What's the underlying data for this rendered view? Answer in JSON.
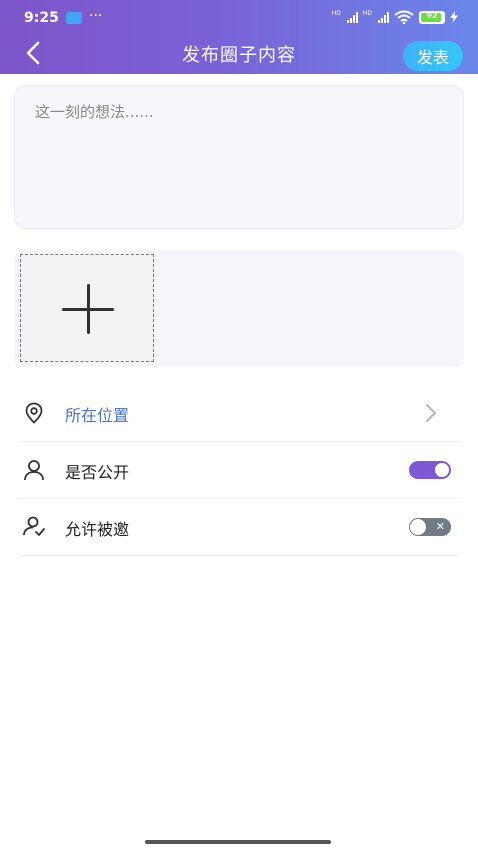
{
  "status_bar": {
    "time": "9:25",
    "overflow": "···",
    "hd1": "HD",
    "hd2": "HD",
    "battery": "92"
  },
  "header": {
    "title": "发布圈子内容",
    "publish_label": "发表"
  },
  "post": {
    "placeholder": "这一刻的想法......"
  },
  "settings": [
    {
      "label": "所在位置",
      "icon": "location-pin-icon",
      "control": "chevron",
      "label_color": "#4a72c6"
    },
    {
      "label": "是否公开",
      "icon": "person-icon",
      "control": "toggle",
      "enabled": true
    },
    {
      "label": "允许被邀",
      "icon": "person-check-icon",
      "control": "toggle",
      "enabled": false
    }
  ],
  "colors": {
    "header_start": "#7d56c9",
    "header_end": "#6a86ea",
    "accent": "#7d59d8",
    "publish_button": "#3fb3f5"
  }
}
